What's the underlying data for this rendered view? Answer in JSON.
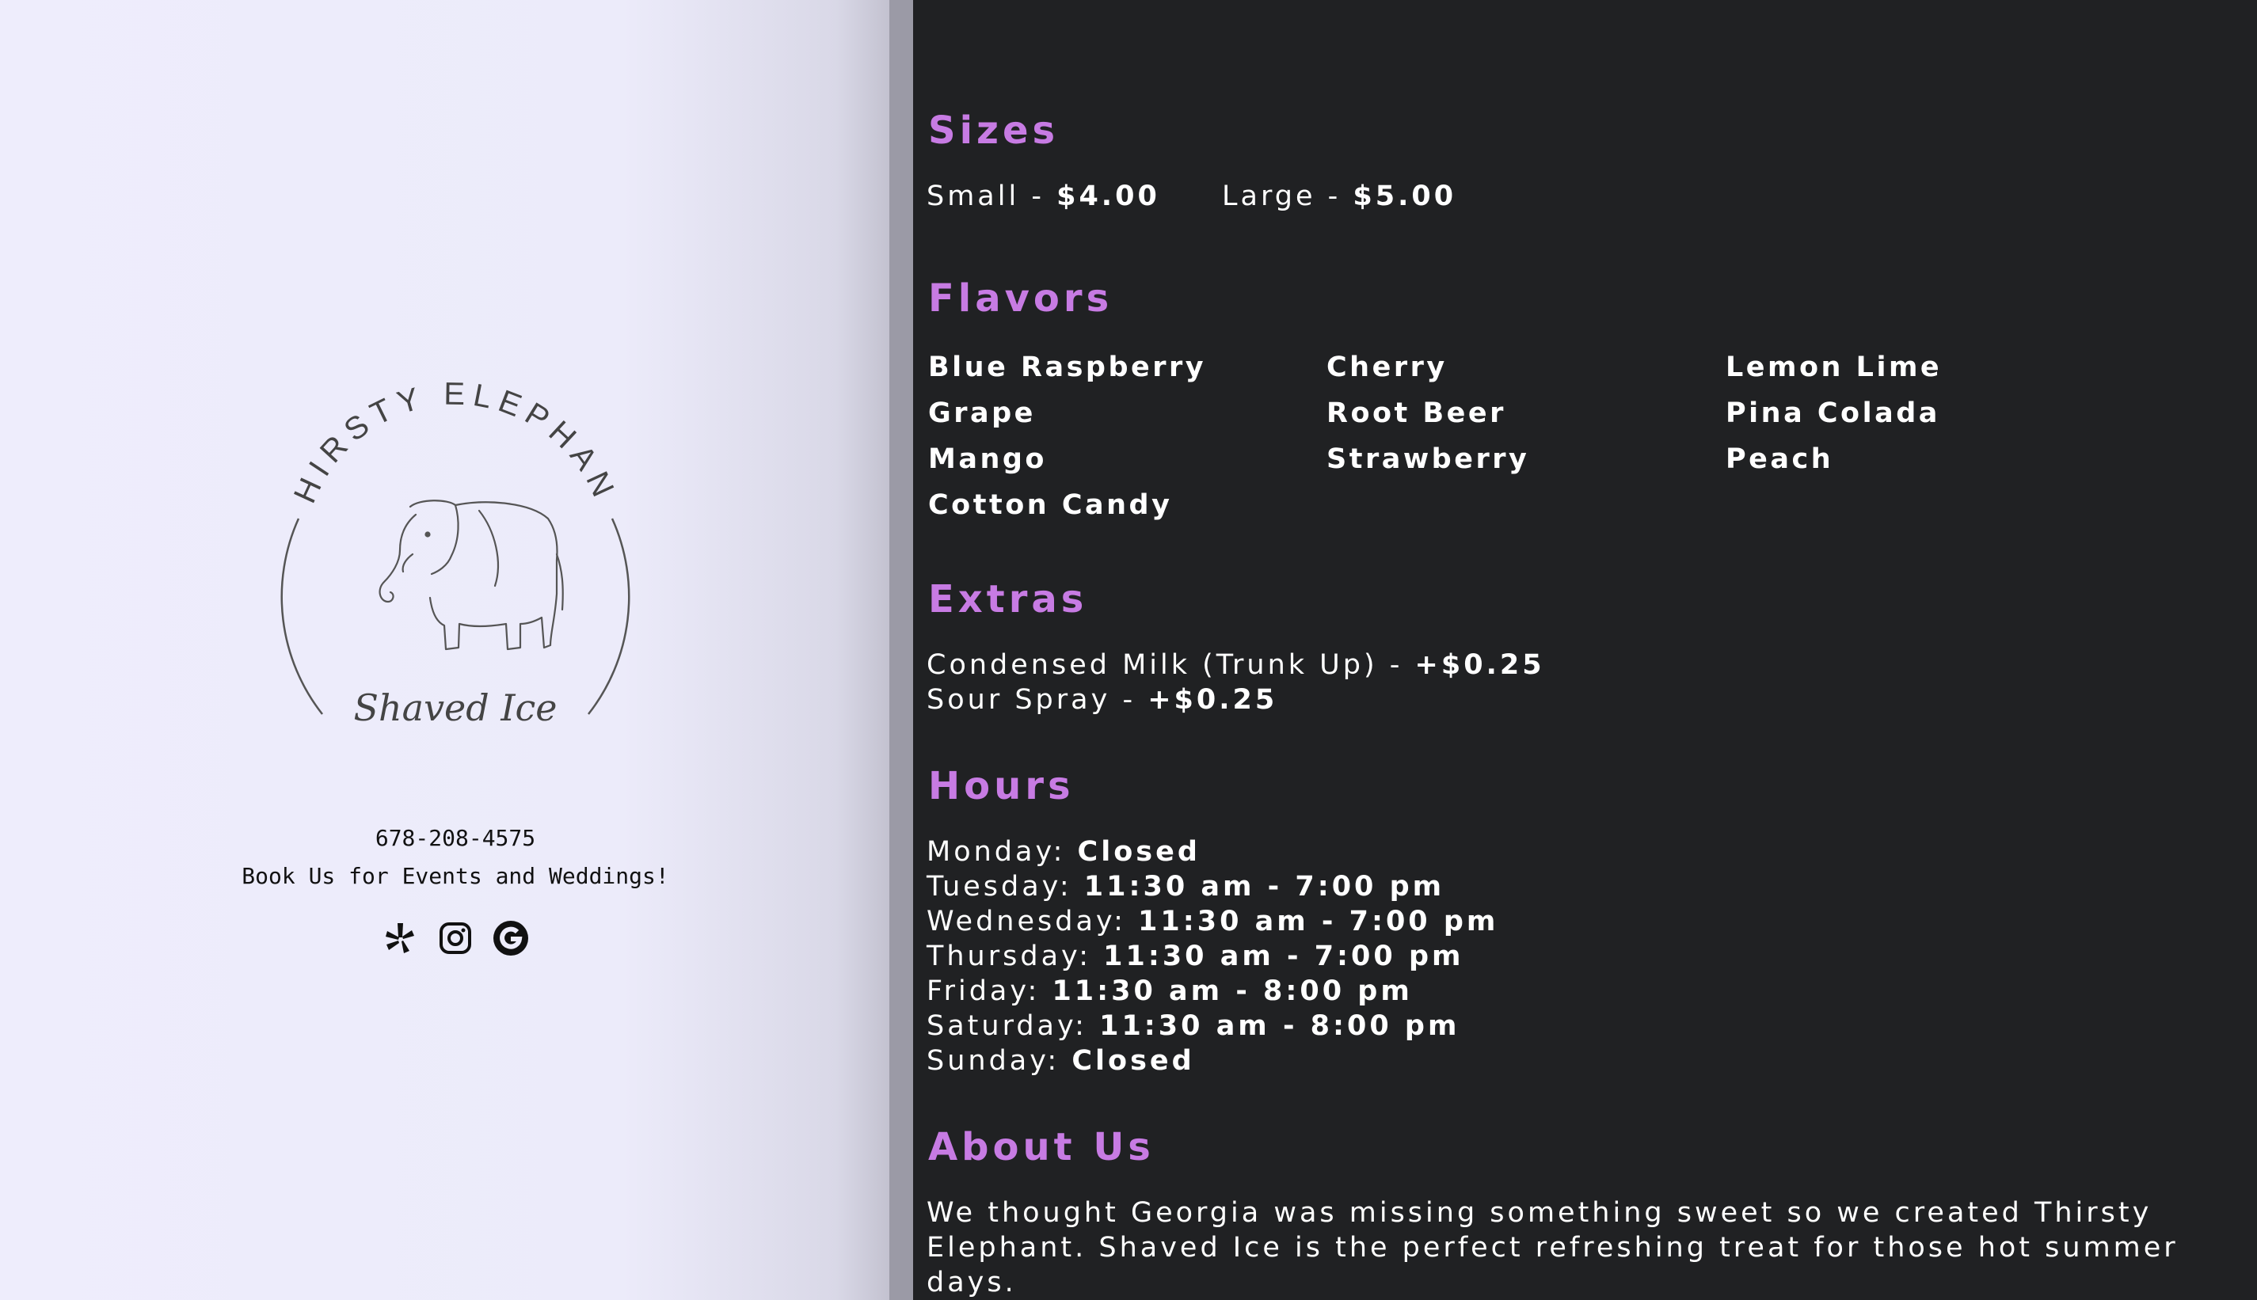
{
  "brand": {
    "logo_arc_text": "THIRSTY ELEPHANT",
    "logo_script_text": "Shaved Ice",
    "phone": "678-208-4575",
    "tagline": "Book Us for Events and Weddings!",
    "social_icons": [
      "yelp-icon",
      "instagram-icon",
      "google-icon"
    ]
  },
  "sizes": {
    "title": "Sizes",
    "small_label": "Small - ",
    "small_price": "$4.00",
    "large_label": "Large - ",
    "large_price": "$5.00"
  },
  "flavors": {
    "title": "Flavors",
    "items": [
      "Blue Raspberry",
      "Cherry",
      "Lemon Lime",
      "Grape",
      "Root Beer",
      "Pina Colada",
      "Mango",
      "Strawberry",
      "Peach",
      "Cotton Candy"
    ]
  },
  "extras": {
    "title": "Extras",
    "items": [
      {
        "label": "Condensed Milk (Trunk Up) - ",
        "price": "+$0.25"
      },
      {
        "label": "Sour Spray - ",
        "price": "+$0.25"
      }
    ]
  },
  "hours": {
    "title": "Hours",
    "days": [
      {
        "day": "Monday: ",
        "time": "Closed"
      },
      {
        "day": "Tuesday: ",
        "time": "11:30 am - 7:00 pm"
      },
      {
        "day": "Wednesday: ",
        "time": "11:30 am - 7:00 pm"
      },
      {
        "day": "Thursday: ",
        "time": "11:30 am - 7:00 pm"
      },
      {
        "day": "Friday: ",
        "time": "11:30 am - 8:00 pm"
      },
      {
        "day": "Saturday: ",
        "time": "11:30 am - 8:00 pm"
      },
      {
        "day": "Sunday: ",
        "time": "Closed"
      }
    ]
  },
  "about": {
    "title": "About Us",
    "lines": [
      "We thought Georgia was missing something sweet so we created Thirsty",
      "Elephant. Shaved Ice is the perfect refreshing treat for those hot summer",
      "days."
    ]
  },
  "colors": {
    "accent": "#c77be3",
    "dark_bg": "#202123",
    "light_bg": "#eeedfc"
  }
}
